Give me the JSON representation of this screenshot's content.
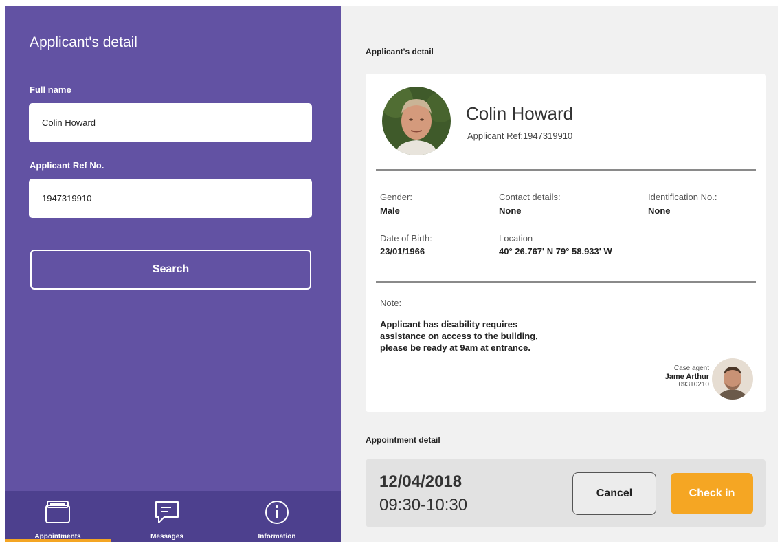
{
  "left_panel": {
    "title": "Applicant's detail",
    "full_name_label": "Full name",
    "full_name_value": "Colin Howard",
    "ref_label": "Applicant Ref No.",
    "ref_value": "1947319910",
    "search_label": "Search"
  },
  "bottom_nav": {
    "items": [
      {
        "label": "Appointments",
        "icon": "calendar-icon",
        "active": true
      },
      {
        "label": "Messages",
        "icon": "message-icon"
      },
      {
        "label": "Information",
        "icon": "info-icon"
      }
    ]
  },
  "detail": {
    "section_title": "Applicant's detail",
    "name": "Colin Howard",
    "ref": "Applicant Ref:1947319910",
    "gender_label": "Gender:",
    "gender_value": "Male",
    "contact_label": "Contact details:",
    "contact_value": "None",
    "id_label": "Identification No.:",
    "id_value": "None",
    "dob_label": "Date of Birth:",
    "dob_value": "23/01/1966",
    "location_label": "Location",
    "location_value": "40° 26.767' N 79° 58.933' W",
    "note_label": "Note:",
    "note_lines": [
      "Applicant has disability requires",
      "assistance on access to the building,",
      "please be ready at 9am at entrance."
    ],
    "agent_role": "Case agent",
    "agent_name": "Jame Arthur",
    "agent_id": "09310210"
  },
  "appointment": {
    "section_title": "Appointment detail",
    "date": "12/04/2018",
    "time": "09:30-10:30",
    "cancel_label": "Cancel",
    "checkin_label": "Check in"
  },
  "colors": {
    "panel": "#6252a3",
    "nav": "#4d408e",
    "accent": "#f5a623"
  }
}
